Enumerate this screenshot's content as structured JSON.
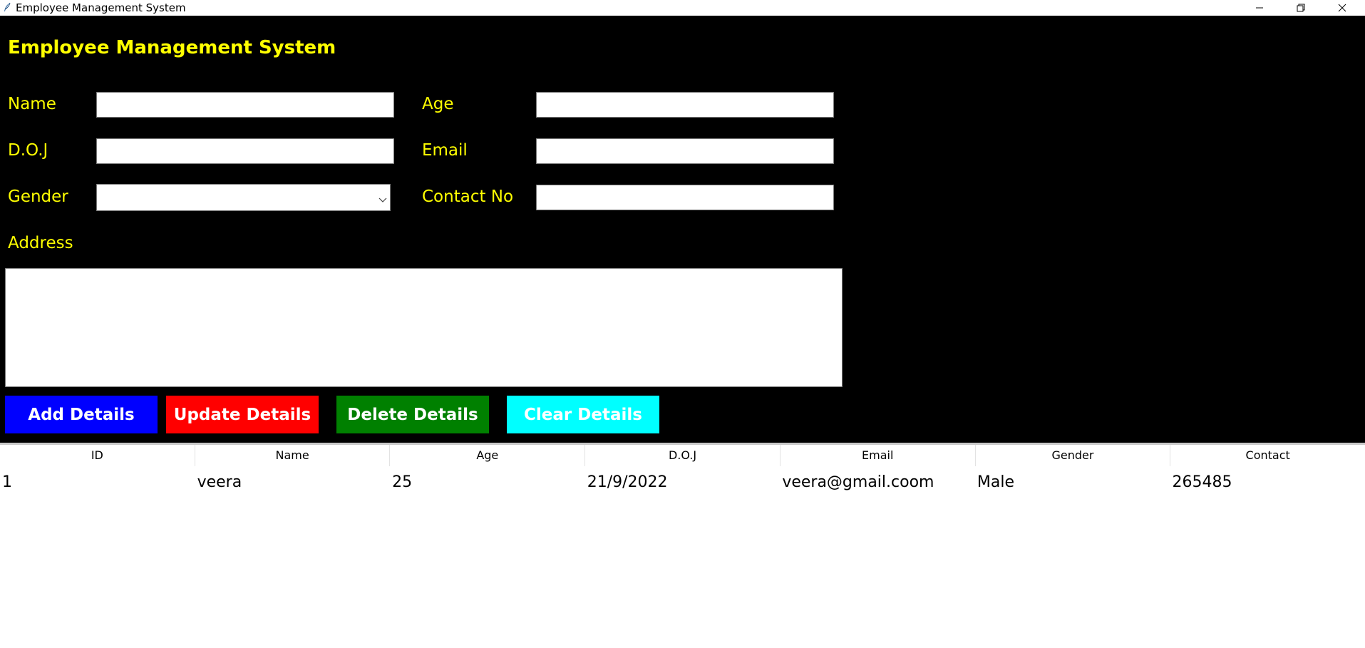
{
  "window": {
    "title": "Employee Management System",
    "controls": {
      "minimize": "minimize-icon",
      "maximize": "restore-icon",
      "close": "close-icon"
    }
  },
  "form": {
    "heading": "Employee Management System",
    "labels": {
      "name": "Name",
      "age": "Age",
      "doj": "D.O.J",
      "email": "Email",
      "gender": "Gender",
      "contact": "Contact No",
      "address": "Address"
    },
    "values": {
      "name": "",
      "age": "",
      "doj": "",
      "email": "",
      "gender": "",
      "contact": "",
      "address": ""
    },
    "buttons": {
      "add": "Add Details",
      "update": "Update Details",
      "delete": "Delete Details",
      "clear": "Clear Details"
    },
    "colors": {
      "background": "#000000",
      "label": "#ffff00",
      "add": "#0000ff",
      "update": "#ff0000",
      "delete": "#008000",
      "clear": "#00ffff"
    }
  },
  "table": {
    "columns": [
      "ID",
      "Name",
      "Age",
      "D.O.J",
      "Email",
      "Gender",
      "Contact"
    ],
    "rows": [
      [
        "1",
        "veera",
        "25",
        "21/9/2022",
        "veera@gmail.coom",
        "Male",
        "265485"
      ]
    ]
  }
}
